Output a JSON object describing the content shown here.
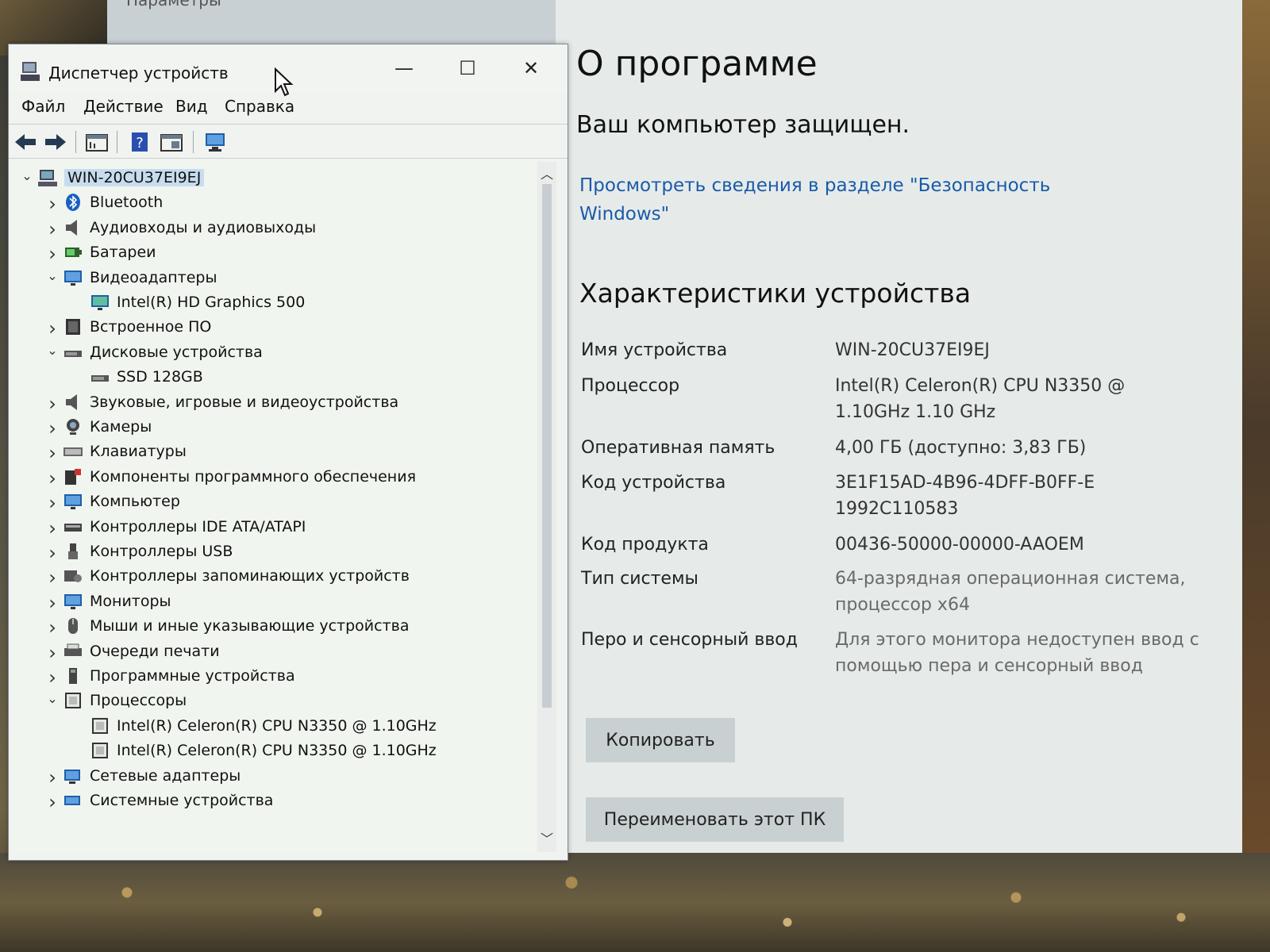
{
  "settings": {
    "header_text": "Параметры",
    "page_title": "О программе",
    "protection_status": "Ваш компьютер защищен.",
    "security_link": "Просмотреть сведения в разделе \"Безопасность Windows\"",
    "specs_title": "Характеристики устройства",
    "specs": [
      {
        "label": "Имя устройства",
        "value": "WIN-20CU37EI9EJ"
      },
      {
        "label": "Процессор",
        "value": "Intel(R) Celeron(R) CPU N3350 @ 1.10GHz   1.10 GHz"
      },
      {
        "label": "Оперативная память",
        "value": "4,00 ГБ (доступно: 3,83 ГБ)"
      },
      {
        "label": "Код устройства",
        "value": "3E1F15AD-4B96-4DFF-B0FF-E1992C110583"
      },
      {
        "label": "Код продукта",
        "value": "00436-50000-00000-AAOEM"
      },
      {
        "label": "Тип системы",
        "value": "64-разрядная операционная система, процессор x64"
      },
      {
        "label": "Перо и сенсорный ввод",
        "value": "Для этого монитора недоступен ввод с помощью пера и сенсорный ввод"
      }
    ],
    "copy_button": "Копировать",
    "rename_button": "Переименовать этот ПК"
  },
  "device_manager": {
    "title": "Диспетчер устройств",
    "controls": {
      "minimize": "—",
      "maximize": "☐",
      "close": "✕"
    },
    "menu": [
      "Файл",
      "Действие",
      "Вид",
      "Справка"
    ],
    "tree": [
      {
        "label": "WIN-20CU37EI9EJ",
        "level": 0,
        "expanded": true,
        "icon": "computer-icon"
      },
      {
        "label": "Bluetooth",
        "level": 1,
        "expanded": false,
        "icon": "bluetooth-icon"
      },
      {
        "label": "Аудиовходы и аудиовыходы",
        "level": 1,
        "expanded": false,
        "icon": "speaker-icon"
      },
      {
        "label": "Батареи",
        "level": 1,
        "expanded": false,
        "icon": "battery-icon"
      },
      {
        "label": "Видеоадаптеры",
        "level": 1,
        "expanded": true,
        "icon": "monitor-icon"
      },
      {
        "label": "Intel(R) HD Graphics 500",
        "level": 2,
        "icon": "display-adapter-icon"
      },
      {
        "label": "Встроенное ПО",
        "level": 1,
        "expanded": false,
        "icon": "firmware-icon"
      },
      {
        "label": "Дисковые устройства",
        "level": 1,
        "expanded": true,
        "icon": "disk-icon"
      },
      {
        "label": "SSD 128GB",
        "level": 2,
        "icon": "disk-icon"
      },
      {
        "label": "Звуковые, игровые и видеоустройства",
        "level": 1,
        "expanded": false,
        "icon": "speaker-icon"
      },
      {
        "label": "Камеры",
        "level": 1,
        "expanded": false,
        "icon": "camera-icon"
      },
      {
        "label": "Клавиатуры",
        "level": 1,
        "expanded": false,
        "icon": "keyboard-icon"
      },
      {
        "label": "Компоненты программного обеспечения",
        "level": 1,
        "expanded": false,
        "icon": "software-component-icon"
      },
      {
        "label": "Компьютер",
        "level": 1,
        "expanded": false,
        "icon": "monitor-icon"
      },
      {
        "label": "Контроллеры IDE ATA/ATAPI",
        "level": 1,
        "expanded": false,
        "icon": "ide-controller-icon"
      },
      {
        "label": "Контроллеры USB",
        "level": 1,
        "expanded": false,
        "icon": "usb-icon"
      },
      {
        "label": "Контроллеры запоминающих устройств",
        "level": 1,
        "expanded": false,
        "icon": "storage-controller-icon"
      },
      {
        "label": "Мониторы",
        "level": 1,
        "expanded": false,
        "icon": "monitor-icon"
      },
      {
        "label": "Мыши и иные указывающие устройства",
        "level": 1,
        "expanded": false,
        "icon": "mouse-icon"
      },
      {
        "label": "Очереди печати",
        "level": 1,
        "expanded": false,
        "icon": "printer-icon"
      },
      {
        "label": "Программные устройства",
        "level": 1,
        "expanded": false,
        "icon": "software-device-icon"
      },
      {
        "label": "Процессоры",
        "level": 1,
        "expanded": true,
        "icon": "processor-icon"
      },
      {
        "label": "Intel(R) Celeron(R) CPU N3350 @ 1.10GHz",
        "level": 2,
        "icon": "processor-icon"
      },
      {
        "label": "Intel(R) Celeron(R) CPU N3350 @ 1.10GHz",
        "level": 2,
        "icon": "processor-icon"
      },
      {
        "label": "Сетевые адаптеры",
        "level": 1,
        "expanded": false,
        "icon": "network-adapter-icon"
      },
      {
        "label": "Системные устройства",
        "level": 1,
        "expanded": false,
        "icon": "system-device-icon"
      }
    ]
  }
}
